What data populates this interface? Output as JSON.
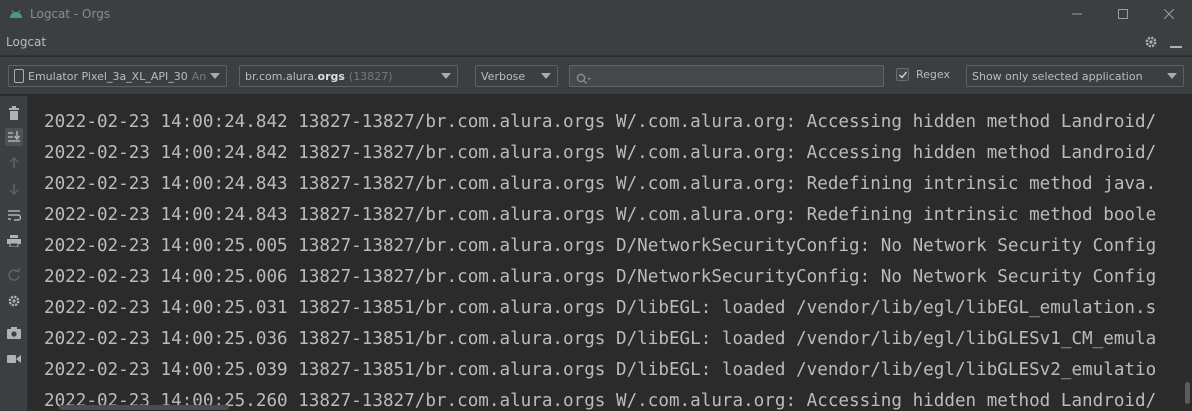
{
  "window": {
    "title": "Logcat - Orgs",
    "controls": [
      "minimize",
      "maximize",
      "close"
    ]
  },
  "panel": {
    "title": "Logcat"
  },
  "toolbar": {
    "device": {
      "label": "Emulator Pixel_3a_XL_API_30",
      "suffix": "An"
    },
    "process": {
      "package_prefix": "br.com.alura.",
      "package_bold": "orgs",
      "pid": "(13827)"
    },
    "log_level": "Verbose",
    "search": {
      "value": "",
      "placeholder": ""
    },
    "regex": {
      "label": "Regex",
      "checked": true
    },
    "filter": "Show only selected application"
  },
  "sidebar": {
    "icons": [
      "trash-icon",
      "scroll-to-end-icon",
      "up-arrow-icon",
      "down-arrow-icon",
      "soft-wrap-icon",
      "print-icon",
      "restart-icon",
      "settings-icon",
      "screenshot-icon",
      "screen-record-icon"
    ]
  },
  "log": {
    "lines": [
      "2022-02-23 14:00:24.842 13827-13827/br.com.alura.orgs W/.com.alura.org: Accessing hidden method Landroid/",
      "2022-02-23 14:00:24.842 13827-13827/br.com.alura.orgs W/.com.alura.org: Accessing hidden method Landroid/",
      "2022-02-23 14:00:24.843 13827-13827/br.com.alura.orgs W/.com.alura.org: Redefining intrinsic method java.",
      "2022-02-23 14:00:24.843 13827-13827/br.com.alura.orgs W/.com.alura.org: Redefining intrinsic method boole",
      "2022-02-23 14:00:25.005 13827-13827/br.com.alura.orgs D/NetworkSecurityConfig: No Network Security Config",
      "2022-02-23 14:00:25.006 13827-13827/br.com.alura.orgs D/NetworkSecurityConfig: No Network Security Config",
      "2022-02-23 14:00:25.031 13827-13851/br.com.alura.orgs D/libEGL: loaded /vendor/lib/egl/libEGL_emulation.s",
      "2022-02-23 14:00:25.036 13827-13851/br.com.alura.orgs D/libEGL: loaded /vendor/lib/egl/libGLESv1_CM_emula",
      "2022-02-23 14:00:25.039 13827-13851/br.com.alura.orgs D/libEGL: loaded /vendor/lib/egl/libGLESv2_emulatio",
      "2022-02-23 14:00:25.260 13827-13827/br.com.alura.orgs W/.com.alura.org: Accessing hidden method Landroid/"
    ]
  },
  "colors": {
    "background": "#2b2b2b",
    "chrome": "#3c3f41",
    "text": "#bbbbbb"
  }
}
